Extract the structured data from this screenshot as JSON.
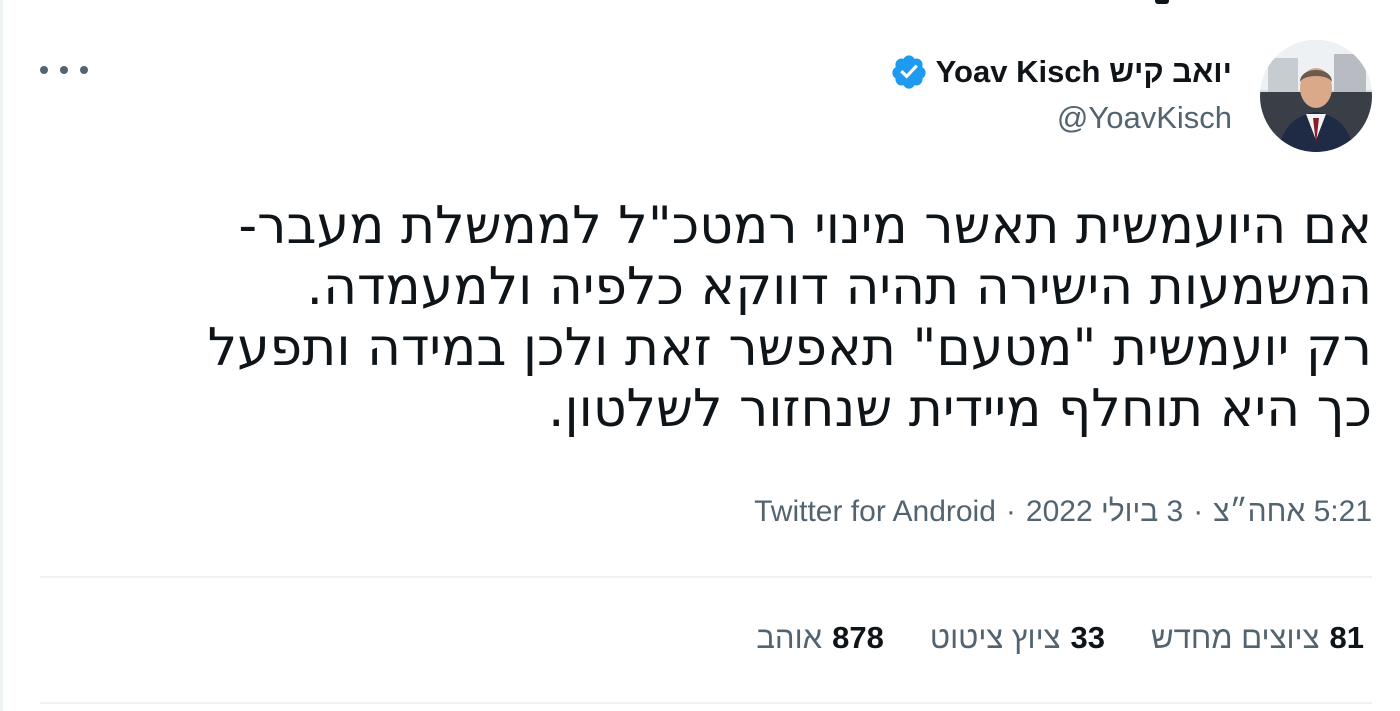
{
  "author": {
    "display_name": "יואב קיש Yoav Kisch",
    "handle": "@YoavKisch",
    "verified": true,
    "avatar_icon": "profile-photo"
  },
  "tweet": {
    "text": "אם היועמשית תאשר מינוי רמטכ\"ל לממשלת מעבר-\nהמשמעות הישירה תהיה דווקא כלפיה ולמעמדה.\nרק יועמשית \"מטעם\" תאפשר זאת ולכן במידה ותפעל\nכך היא תוחלף מיידית שנחזור לשלטון.",
    "time": "5:21 אחה״צ",
    "date": "3 ביולי 2022",
    "separator": "·",
    "source": "Twitter for Android"
  },
  "stats": {
    "retweets_count": "81",
    "retweets_label": "ציוצים מחדש",
    "quotes_count": "33",
    "quotes_label": "ציוץ ציטוט",
    "likes_count": "878",
    "likes_label": "אוהב"
  },
  "colors": {
    "primary_text": "#0f1419",
    "secondary_text": "#536471",
    "verified_blue": "#1d9bf0",
    "divider": "#eff3f4"
  }
}
